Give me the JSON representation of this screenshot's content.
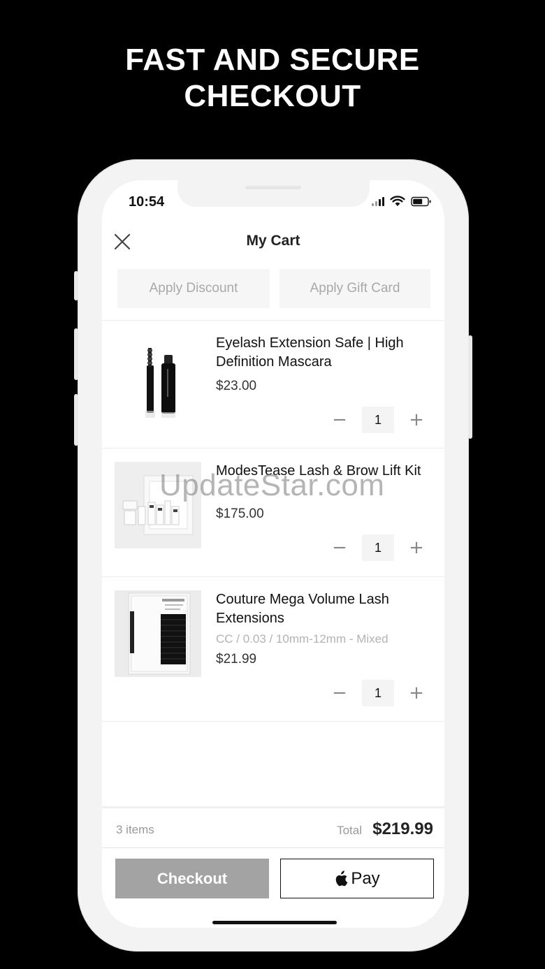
{
  "headline": {
    "line1": "FAST AND SECURE",
    "line2": "CHECKOUT"
  },
  "status_bar": {
    "time": "10:54",
    "icons": [
      "signal-icon",
      "wifi-icon",
      "battery-icon"
    ]
  },
  "header": {
    "title": "My Cart",
    "close_icon": "close-icon"
  },
  "actions": {
    "discount_label": "Apply Discount",
    "gift_card_label": "Apply Gift Card"
  },
  "items": [
    {
      "name": "Eyelash Extension Safe | High Definition Mascara",
      "variant": "",
      "price": "$23.00",
      "quantity": "1"
    },
    {
      "name": "ModesTease Lash & Brow Lift Kit",
      "variant": "",
      "price": "$175.00",
      "quantity": "1"
    },
    {
      "name": "Couture Mega Volume Lash Extensions",
      "variant": "CC / 0.03 / 10mm-12mm - Mixed",
      "price": "$21.99",
      "quantity": "1"
    }
  ],
  "stepper": {
    "minus": "−",
    "plus": "+"
  },
  "footer": {
    "item_count": "3 items",
    "total_label": "Total",
    "total_value": "$219.99",
    "checkout_label": "Checkout",
    "apple_pay_label": "Pay"
  },
  "watermark": "UpdateStar.com",
  "colors": {
    "background": "#000000",
    "checkout_button": "#a3a3a3",
    "muted_text": "#a9a9a9"
  }
}
